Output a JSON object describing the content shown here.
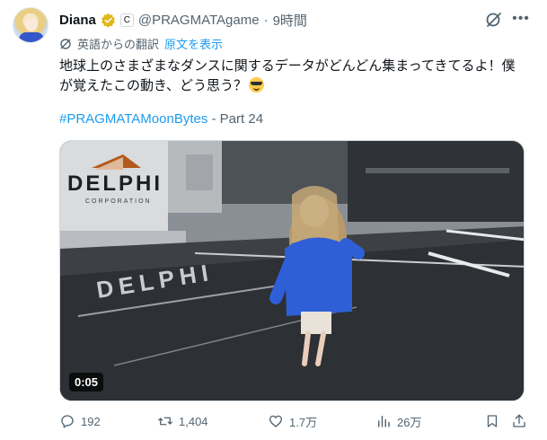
{
  "author": {
    "name": "Diana",
    "handle": "@PRAGMATAgame",
    "separator": "·",
    "time": "9時間"
  },
  "translation": {
    "notice": "英語からの翻訳",
    "show_original": "原文を表示"
  },
  "post": {
    "line1": "地球上のさまざまなダンスに関するデータがどんどん集まってきてるよ！僕",
    "line2": "が覚えたこの動き、どう思う？",
    "emoji": "smiling-face-with-sunglasses",
    "hashtag": "#PRAGMATAMoonBytes",
    "suffix": " - Part 24"
  },
  "media": {
    "duration": "0:05",
    "brand": "DELPHI",
    "brand_sub": "CORPORATION",
    "floor_text": "DELPHI"
  },
  "actions": {
    "replies": "192",
    "reposts": "1,404",
    "likes": "1.7万",
    "views": "26万"
  },
  "colors": {
    "accent": "#1d9bf0",
    "verified_gold": "#e2b719",
    "muted": "#536471",
    "text": "#0f1419"
  }
}
